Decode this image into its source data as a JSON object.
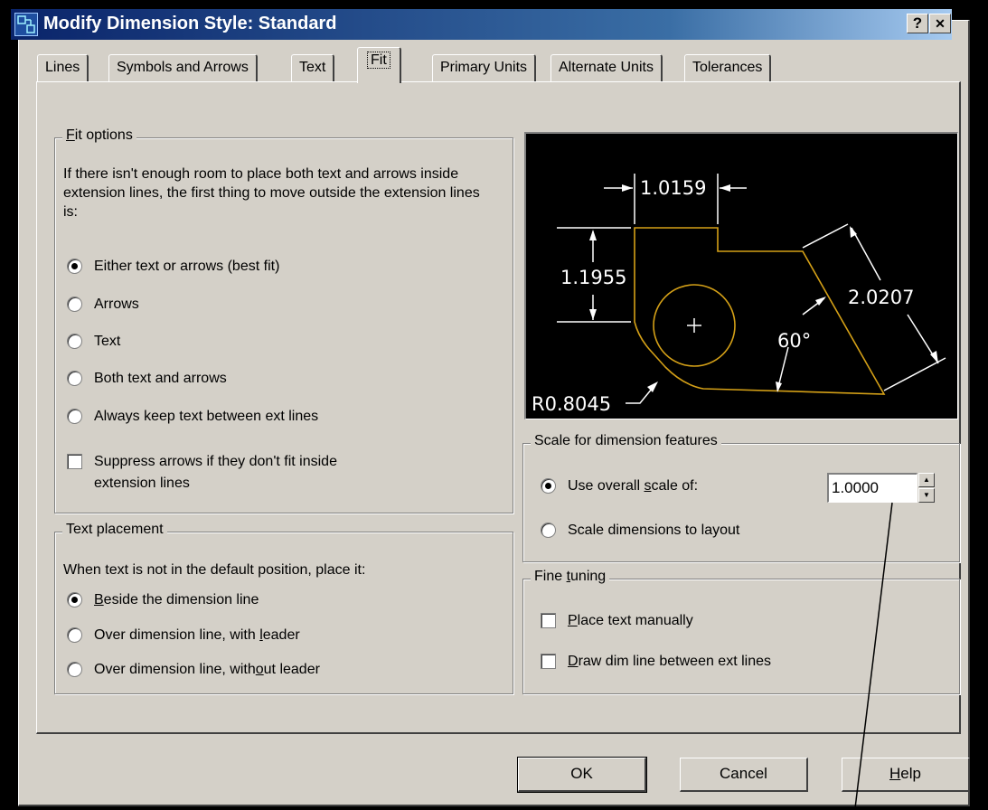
{
  "window": {
    "title": "Modify Dimension Style: Standard",
    "help_button": "?",
    "close_button": "✕"
  },
  "tabs": [
    {
      "label": "Lines",
      "active": false
    },
    {
      "label": "Symbols and Arrows",
      "active": false
    },
    {
      "label": "Text",
      "active": false
    },
    {
      "label": "Fit",
      "active": true
    },
    {
      "label": "Primary Units",
      "active": false
    },
    {
      "label": "Alternate Units",
      "active": false
    },
    {
      "label": "Tolerances",
      "active": false
    }
  ],
  "fit_options": {
    "legend_first": "F",
    "legend_rest": "it options",
    "description": "If there isn't enough room to place both text and arrows inside extension lines, the first thing to move outside the extension lines is:",
    "options": [
      {
        "label": "Either text or arrows (best fit)",
        "selected": true
      },
      {
        "label": "Arrows",
        "selected": false
      },
      {
        "label": "Text",
        "selected": false
      },
      {
        "label": "Both text and arrows",
        "selected": false
      },
      {
        "label": "Always keep text between ext lines",
        "selected": false
      }
    ],
    "suppress_arrows_line1": "Suppress arrows if they don't fit inside",
    "suppress_arrows_line2": "extension lines",
    "suppress_arrows_checked": false
  },
  "text_placement": {
    "legend": "Text placement",
    "description": "When text is not in the default position, place it:",
    "options": [
      {
        "label_pre": "",
        "label_key": "B",
        "label_post": "eside the dimension line",
        "selected": true
      },
      {
        "label_pre": "Over dimension line, with ",
        "label_key": "l",
        "label_post": "eader",
        "selected": false
      },
      {
        "label_pre": "Over dimension line, with",
        "label_key": "o",
        "label_post": "ut leader",
        "selected": false
      }
    ]
  },
  "preview": {
    "dim_horizontal": "1.0159",
    "dim_vertical": "1.1955",
    "dim_aligned": "2.0207",
    "dim_angle": "60°",
    "dim_radius": "R0.8045",
    "geometry_color": "#d4a017",
    "dim_color": "#ffffff"
  },
  "scale": {
    "legend": "Scale for dimension features",
    "use_overall_pre": "Use overall ",
    "use_overall_key": "s",
    "use_overall_post": "cale of:",
    "use_overall_selected": true,
    "scale_value": "1.0000",
    "scale_to_layout": "Scale dimensions to layout",
    "scale_to_layout_selected": false
  },
  "fine_tuning": {
    "legend_pre": "Fine ",
    "legend_key": "t",
    "legend_post": "uning",
    "place_manually_key": "P",
    "place_manually_rest": "lace text manually",
    "place_manually_checked": false,
    "draw_dim_key": "D",
    "draw_dim_rest": "raw dim line between ext lines",
    "draw_dim_checked": false
  },
  "buttons": {
    "ok": "OK",
    "cancel": "Cancel",
    "help_key": "H",
    "help_rest": "elp"
  }
}
